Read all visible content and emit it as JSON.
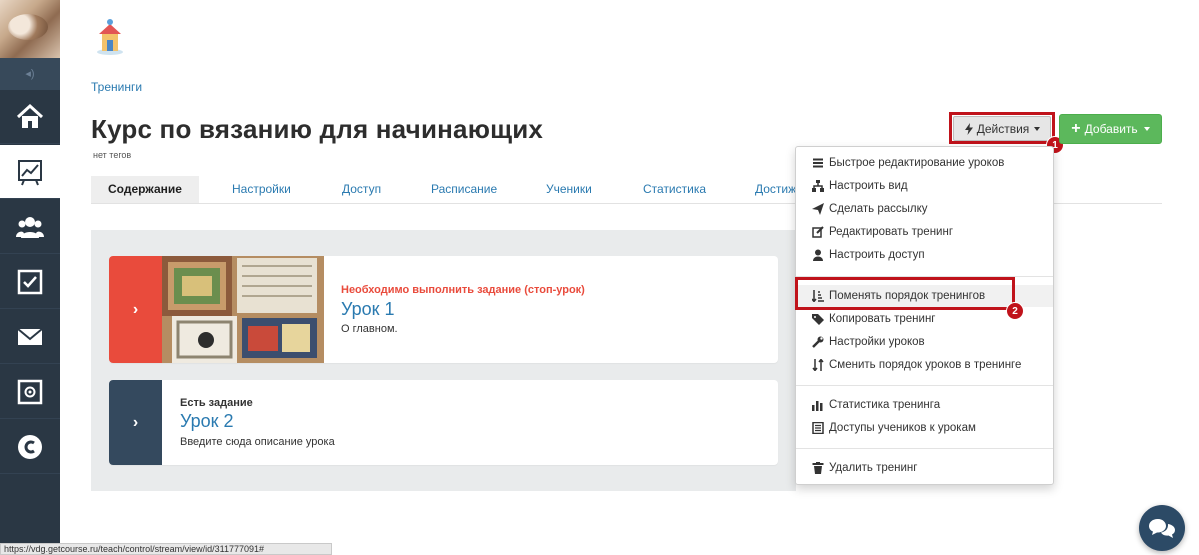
{
  "breadcrumb": "Тренинги",
  "title": "Курс по вязанию для начинающих",
  "tags_label": "нет тегов",
  "tabs": [
    {
      "label": "Содержание"
    },
    {
      "label": "Настройки"
    },
    {
      "label": "Доступ"
    },
    {
      "label": "Расписание"
    },
    {
      "label": "Ученики"
    },
    {
      "label": "Статистика"
    },
    {
      "label": "Достиж"
    }
  ],
  "toolbar": {
    "actions_label": "Действия",
    "add_label": "Добавить",
    "accent_color": "#5cb85c",
    "highlight_color": "#c0131b"
  },
  "markers": {
    "first": "1",
    "second": "2"
  },
  "lessons": [
    {
      "status": "Необходимо выполнить задание (стоп-урок)",
      "status_color": "#e94b3c",
      "title": "Урок 1",
      "description": "О главном.",
      "arrow_color": "#e94b3c",
      "has_image": true
    },
    {
      "status": "Есть задание",
      "status_color": "#333333",
      "title": "Урок 2",
      "description": "Введите сюда описание урока",
      "arrow_color": "#34495e",
      "has_image": false
    }
  ],
  "dropdown": {
    "group1": [
      {
        "label": "Быстрое редактирование уроков",
        "icon": "list-icon"
      },
      {
        "label": "Настроить вид",
        "icon": "sitemap-icon"
      },
      {
        "label": "Сделать рассылку",
        "icon": "send-icon"
      },
      {
        "label": "Редактировать тренинг",
        "icon": "edit-icon"
      },
      {
        "label": "Настроить доступ",
        "icon": "user-icon"
      }
    ],
    "group2": [
      {
        "label": "Поменять порядок тренингов",
        "icon": "sort-icon"
      },
      {
        "label": "Копировать тренинг",
        "icon": "tag-icon"
      },
      {
        "label": "Настройки уроков",
        "icon": "wrench-icon"
      },
      {
        "label": "Сменить порядок уроков в тренинге",
        "icon": "swap-icon"
      }
    ],
    "group3": [
      {
        "label": "Статистика тренинга",
        "icon": "bar-chart-icon"
      },
      {
        "label": "Доступы учеников к урокам",
        "icon": "document-icon"
      }
    ],
    "group4": [
      {
        "label": "Удалить тренинг",
        "icon": "trash-icon"
      }
    ]
  },
  "status_url": "https://vdg.getcourse.ru/teach/control/stream/view/id/311777091#"
}
